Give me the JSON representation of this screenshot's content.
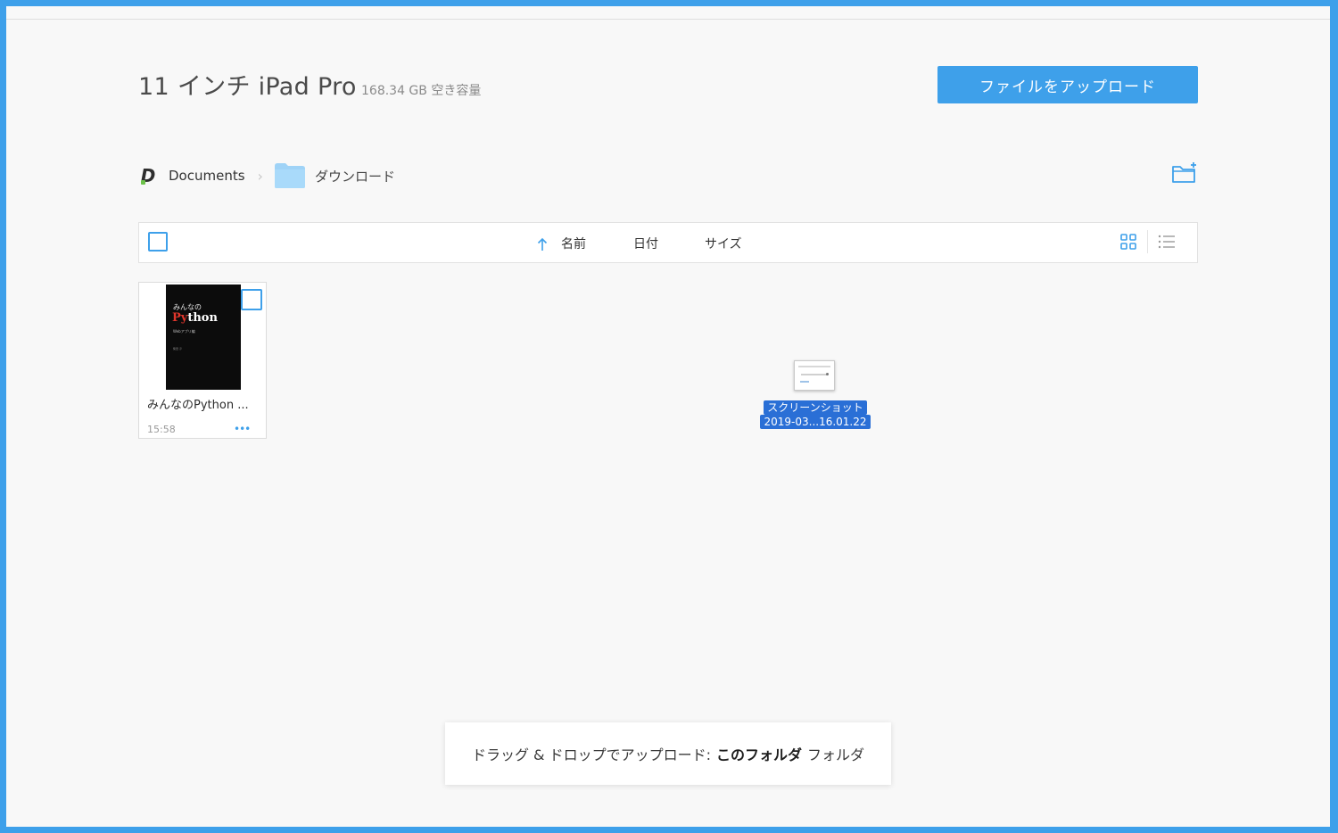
{
  "header": {
    "device_name": "11 インチ iPad Pro",
    "free_space": "168.34 GB 空き容量",
    "upload_button": "ファイルをアップロード"
  },
  "breadcrumb": {
    "root": "Documents",
    "current_folder": "ダウンロード"
  },
  "list_header": {
    "columns": [
      "名前",
      "日付",
      "サイズ"
    ],
    "sort_column": "名前",
    "sort_direction": "ascending",
    "view_mode": "grid"
  },
  "files": [
    {
      "name": "みんなのPython ...",
      "time": "15:58",
      "more": "•••",
      "cover": {
        "line1": "みんなの",
        "title_py": "Py",
        "title_rest": "thon",
        "line3": "Webアプリ編",
        "line4": "柴田 淳"
      }
    }
  ],
  "drag_item": {
    "name_line1": "スクリーンショット",
    "name_line2": "2019-03...16.01.22"
  },
  "drop_hint": {
    "prefix": "ドラッグ & ドロップでアップロード:",
    "target": "このフォルダ",
    "suffix": "フォルダ"
  },
  "colors": {
    "accent": "#3ea0ea",
    "background": "#f8f8f8",
    "frame": "#3ea0ea",
    "selection": "#2a6fd6"
  },
  "icons": {
    "logo": "documents-app-logo",
    "folder": "folder-icon",
    "new_folder": "new-folder-icon",
    "sort": "arrow-up-icon",
    "grid_view": "grid-view-icon",
    "list_view": "list-view-icon"
  }
}
